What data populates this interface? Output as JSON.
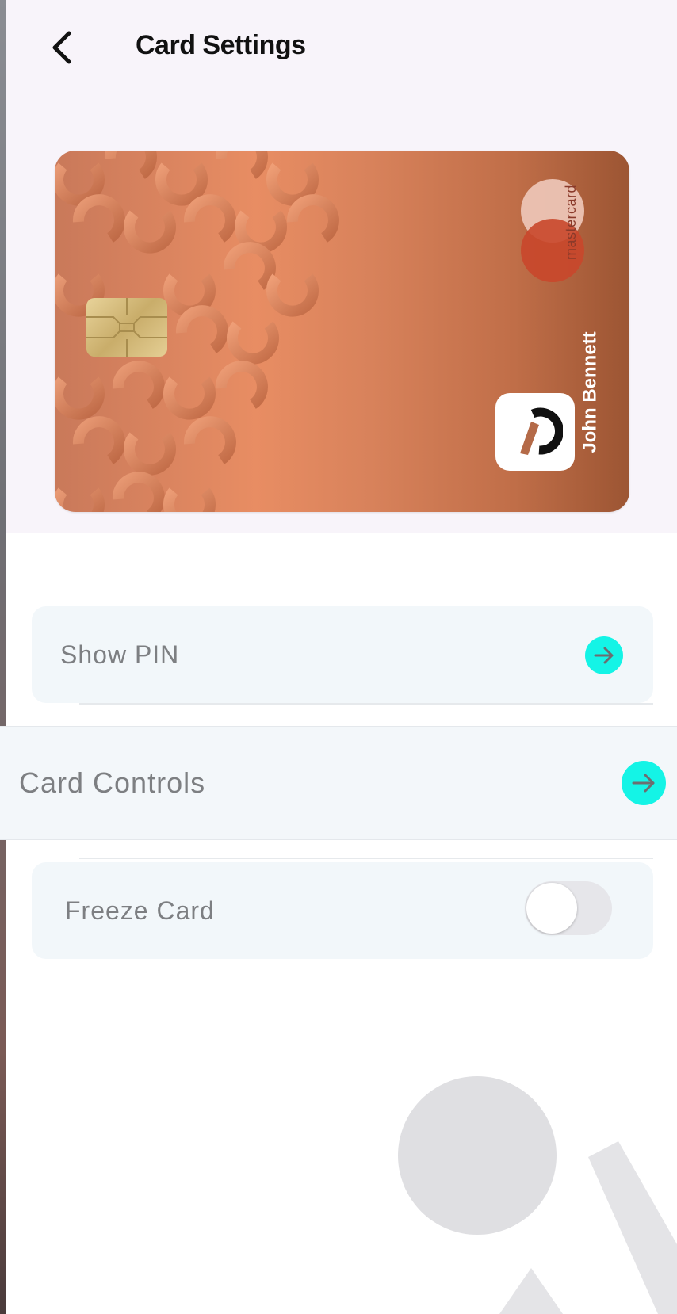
{
  "header": {
    "title": "Card Settings",
    "back_icon": "chevron-left-icon"
  },
  "card": {
    "holder_name": "John Bennett",
    "network": "mastercard",
    "colors": {
      "gradient_start": "#c9795a",
      "gradient_mid": "#e88d63",
      "gradient_end": "#9c5533",
      "mastercard_light": "#ecc4b5",
      "mastercard_dark": "#c9472b"
    },
    "app_logo_icon": "brand-c-logo-icon"
  },
  "settings": {
    "show_pin": {
      "label": "Show PIN",
      "icon": "arrow-right-icon"
    },
    "card_controls": {
      "label": "Card Controls",
      "icon": "arrow-right-icon"
    },
    "freeze_card": {
      "label": "Freeze Card",
      "toggle_on": false
    }
  },
  "theme": {
    "accent": "#14f4e6",
    "row_background": "#f2f7fa",
    "header_background": "#f8f4fa"
  }
}
